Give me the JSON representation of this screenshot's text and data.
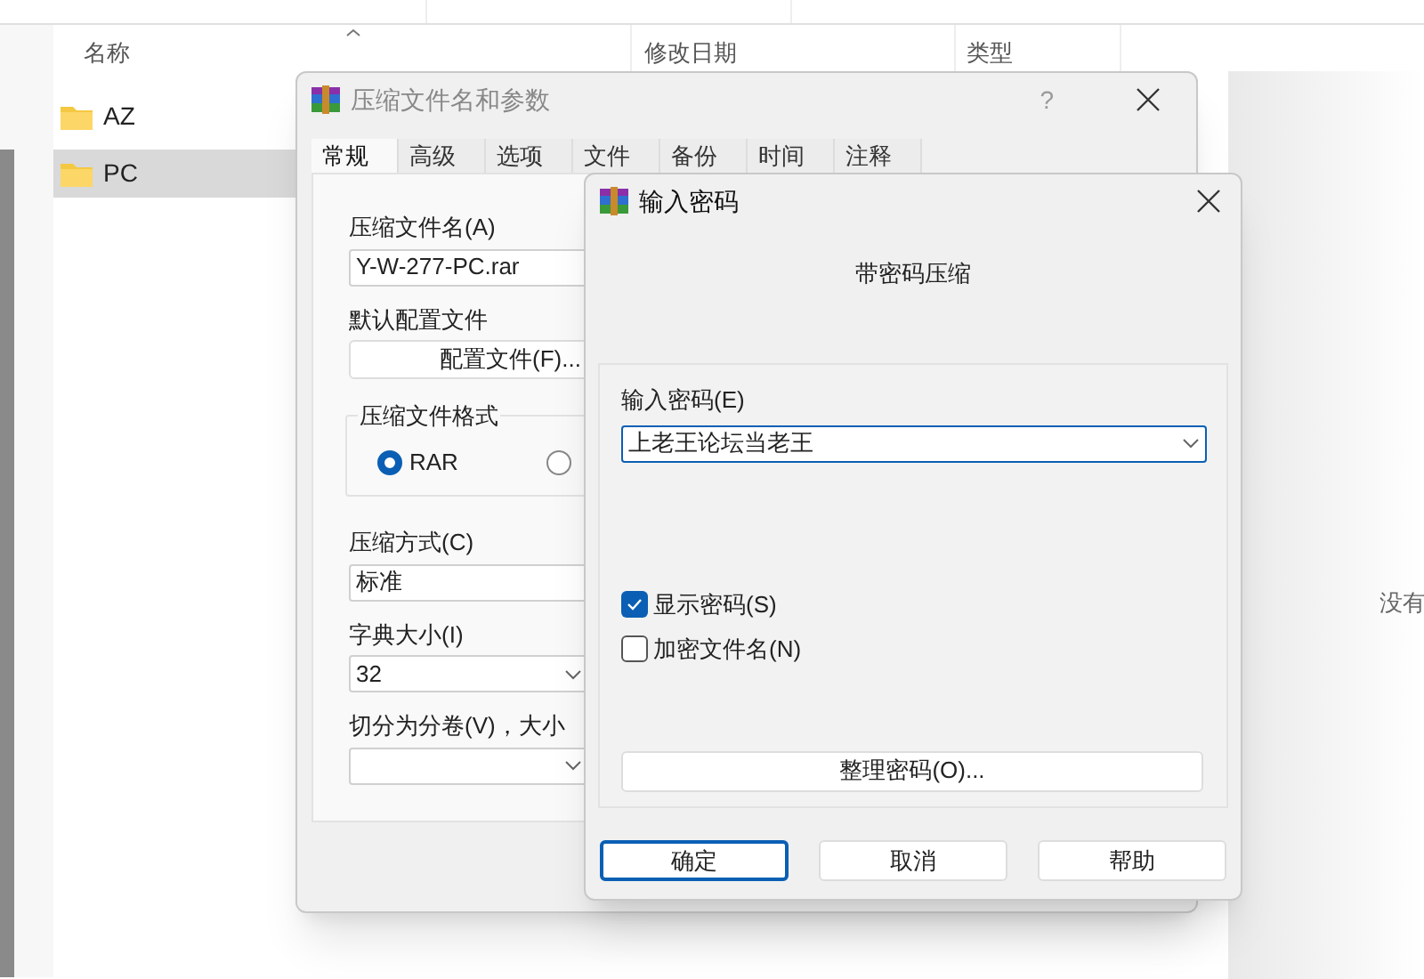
{
  "explorer": {
    "columns": [
      {
        "label": "名称",
        "sorted": true
      },
      {
        "label": "修改日期",
        "sorted": false
      },
      {
        "label": "类型",
        "sorted": false
      }
    ],
    "rows": [
      {
        "name": "AZ",
        "selected": false
      },
      {
        "name": "PC",
        "selected": true
      }
    ],
    "preview_text": "没有"
  },
  "archive_dialog": {
    "title": "压缩文件名和参数",
    "help": "?",
    "tabs": [
      {
        "label": "常规",
        "selected": true
      },
      {
        "label": "高级",
        "selected": false
      },
      {
        "label": "选项",
        "selected": false
      },
      {
        "label": "文件",
        "selected": false
      },
      {
        "label": "备份",
        "selected": false
      },
      {
        "label": "时间",
        "selected": false
      },
      {
        "label": "注释",
        "selected": false
      }
    ],
    "archive_name_label": "压缩文件名(A)",
    "archive_name": "Y-W-277-PC.rar",
    "profile_label": "默认配置文件",
    "profile_button": "配置文件(F)...",
    "format_group": "压缩文件格式",
    "formats": [
      {
        "label": "RAR",
        "selected": true
      },
      {
        "selected": false
      }
    ],
    "method_label": "压缩方式(C)",
    "method": "标准",
    "dict_label": "字典大小(I)",
    "dict": "32",
    "volume_label": "切分为分卷(V)，大小"
  },
  "password_dialog": {
    "title": "输入密码",
    "heading": "带密码压缩",
    "password_label": "输入密码(E)",
    "password": "上老王论坛当老王",
    "options": [
      {
        "label": "显示密码(S)",
        "checked": true
      },
      {
        "label": "加密文件名(N)",
        "checked": false
      }
    ],
    "organize_button": "整理密码(O)...",
    "buttons": [
      {
        "label": "确定",
        "default": true
      },
      {
        "label": "取消",
        "default": false
      },
      {
        "label": "帮助",
        "default": false
      }
    ]
  }
}
